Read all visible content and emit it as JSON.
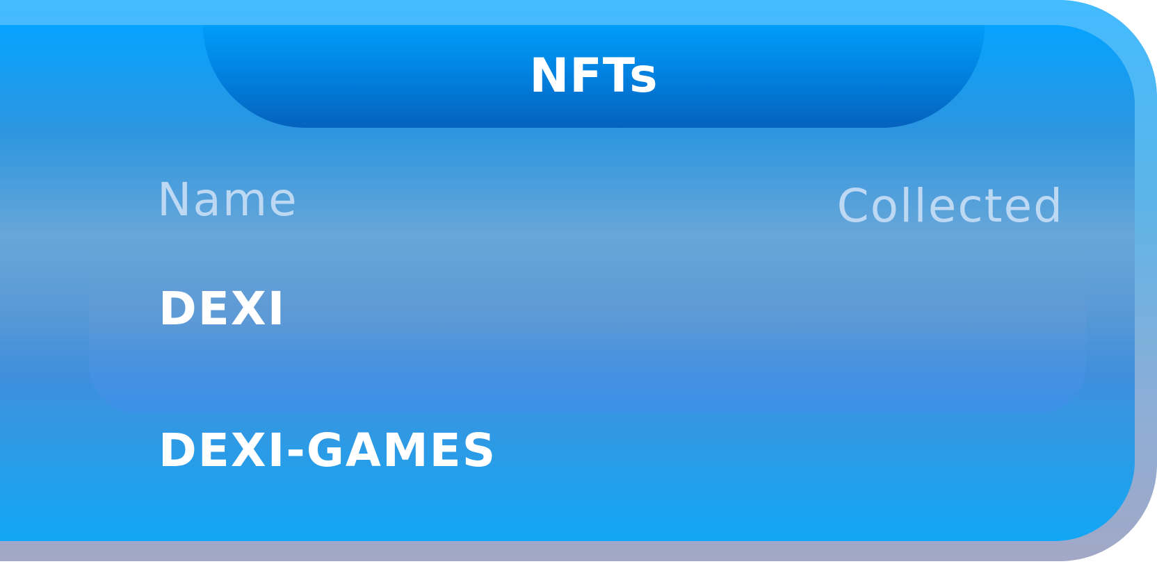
{
  "header": {
    "title": "NFTs"
  },
  "table": {
    "columns": {
      "name": "Name",
      "collected": "Collected"
    },
    "rows": [
      {
        "name": "DEXI",
        "collected": ""
      },
      {
        "name": "DEXI-GAMES",
        "collected": ""
      }
    ]
  },
  "colors": {
    "frame": "#43bbff",
    "panel_top": "#05a3ff",
    "header_tab": "#0180df",
    "column_header_text": "#bcd8f2",
    "row_text": "#ffffff"
  }
}
